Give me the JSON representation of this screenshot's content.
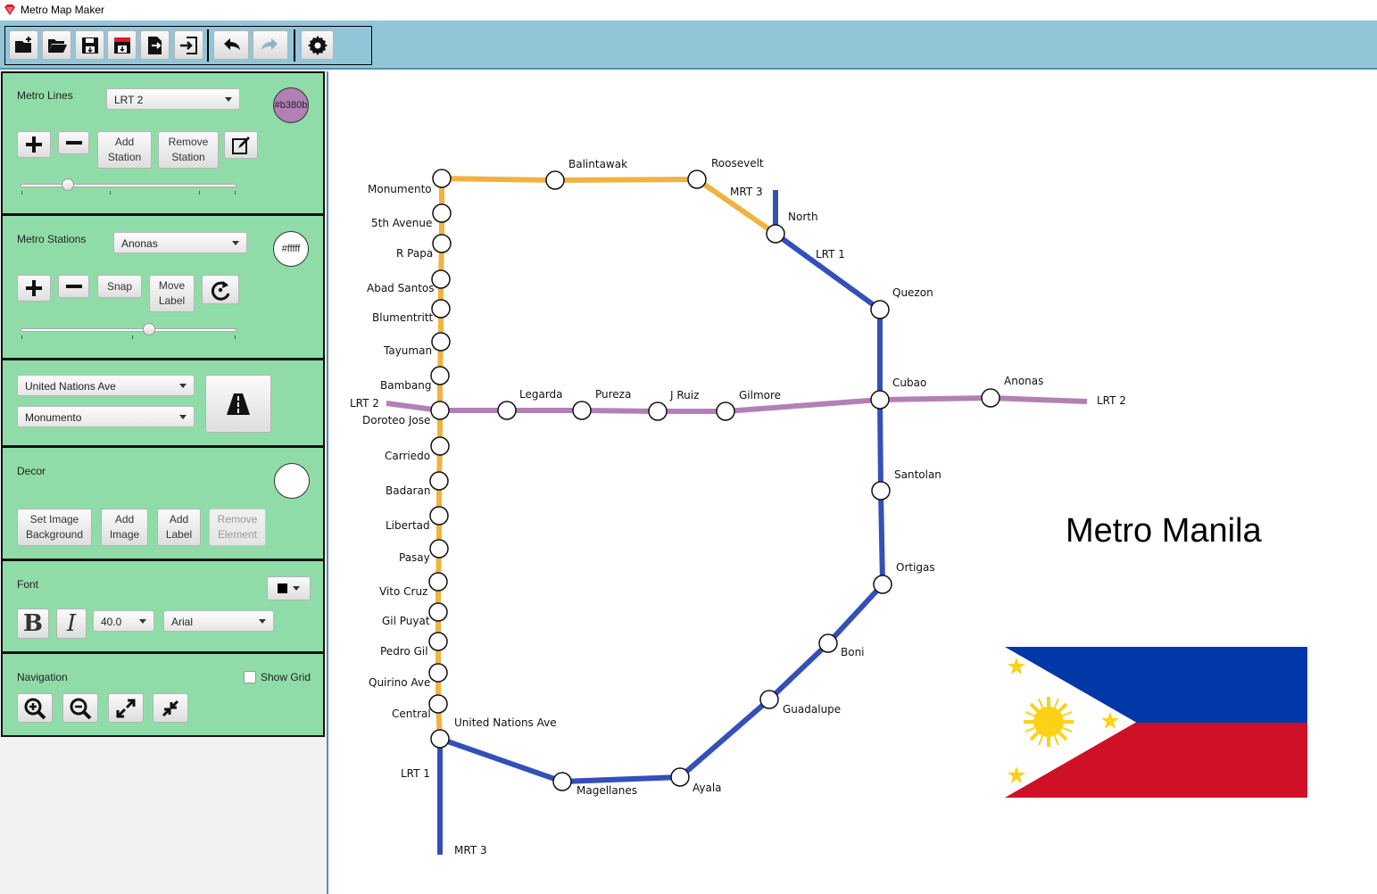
{
  "window": {
    "title": "Metro Map Maker"
  },
  "toolbar": {
    "buttons": [
      {
        "name": "new-map-button",
        "icon": "new-folder-icon"
      },
      {
        "name": "load-map-button",
        "icon": "open-folder-icon"
      },
      {
        "name": "save-map-button",
        "icon": "save-icon"
      },
      {
        "name": "save-as-button",
        "icon": "save-as-icon"
      },
      {
        "name": "export-button",
        "icon": "export-icon"
      },
      {
        "name": "exit-button",
        "icon": "exit-icon"
      },
      {
        "name": "undo-button",
        "icon": "undo-icon",
        "enabled": true
      },
      {
        "name": "redo-button",
        "icon": "redo-icon",
        "enabled": false
      },
      {
        "name": "settings-button",
        "icon": "gear-icon"
      }
    ]
  },
  "metro_lines": {
    "label": "Metro Lines",
    "selected_line": "LRT 2",
    "color_value": "#b380b",
    "color_hex": "#b380b5",
    "add_station": "Add\nStation",
    "remove_station": "Remove\nStation",
    "thickness_fraction": 0.2
  },
  "metro_stations": {
    "label": "Metro Stations",
    "selected_station": "Anonas",
    "color_value": "#fffff",
    "color_hex": "#ffffff",
    "snap": "Snap",
    "move_label": "Move\nLabel",
    "radius_fraction": 0.6
  },
  "route": {
    "from_station": "United Nations Ave",
    "to_station": "Monumento"
  },
  "decor": {
    "label": "Decor",
    "background_color": "#ffffff",
    "set_image_background": "Set Image\nBackground",
    "add_image": "Add\nImage",
    "add_label": "Add\nLabel",
    "remove_element": "Remove\nElement"
  },
  "font": {
    "label": "Font",
    "color": "#000000",
    "bold": "B",
    "italic": "I",
    "size": "40.0",
    "family": "Arial"
  },
  "navigation": {
    "label": "Navigation",
    "show_grid": "Show Grid",
    "show_grid_checked": false
  },
  "map": {
    "title": "Metro Manila",
    "colors": {
      "LRT 1": "#f0b341",
      "LRT 2": "#b380b5",
      "MRT 3": "#3450b8"
    },
    "line_end_labels": [
      "LRT 2",
      "LRT 2",
      "LRT 1",
      "MRT 3",
      "MRT 3",
      "LRT 1"
    ],
    "stations": [
      "Monumento",
      "Balintawak",
      "Roosevelt",
      "North",
      "Quezon",
      "5th Avenue",
      "R Papa",
      "Abad Santos",
      "Blumentritt",
      "Tayuman",
      "Bambang",
      "Doroteo Jose",
      "Legarda",
      "Pureza",
      "J Ruiz",
      "Gilmore",
      "Cubao",
      "Anonas",
      "Carriedo",
      "Badaran",
      "Libertad",
      "Pasay",
      "Santolan",
      "Vito Cruz",
      "Gil Puyat",
      "Pedro Gil",
      "Quirino Ave",
      "Central",
      "United Nations Ave",
      "Ortigas",
      "Boni",
      "Guadalupe",
      "Magellanes",
      "Ayala"
    ],
    "flag": "philippines-flag"
  }
}
